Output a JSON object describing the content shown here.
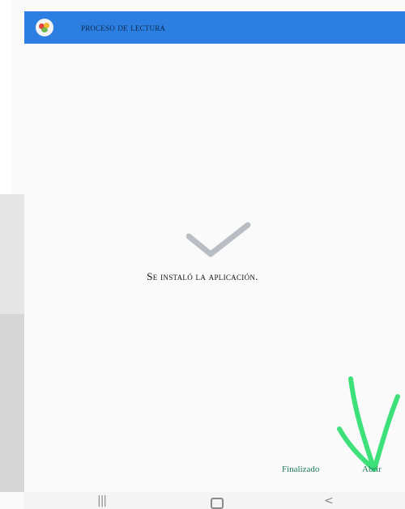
{
  "app": {
    "title": "proceso de lectura"
  },
  "main": {
    "status_message": "Se instaló la aplicación."
  },
  "actions": {
    "finish_label": "Finalizado",
    "open_label": "Abrir"
  },
  "nav": {
    "recents_glyph": "|||",
    "back_glyph": "<"
  },
  "colors": {
    "header_bg": "#2c7fe0",
    "header_text": "#0c2a4d",
    "button_text": "#1d7a5c",
    "annotation_arrow": "#3ee07a",
    "checkmark": "#b9bec4"
  }
}
